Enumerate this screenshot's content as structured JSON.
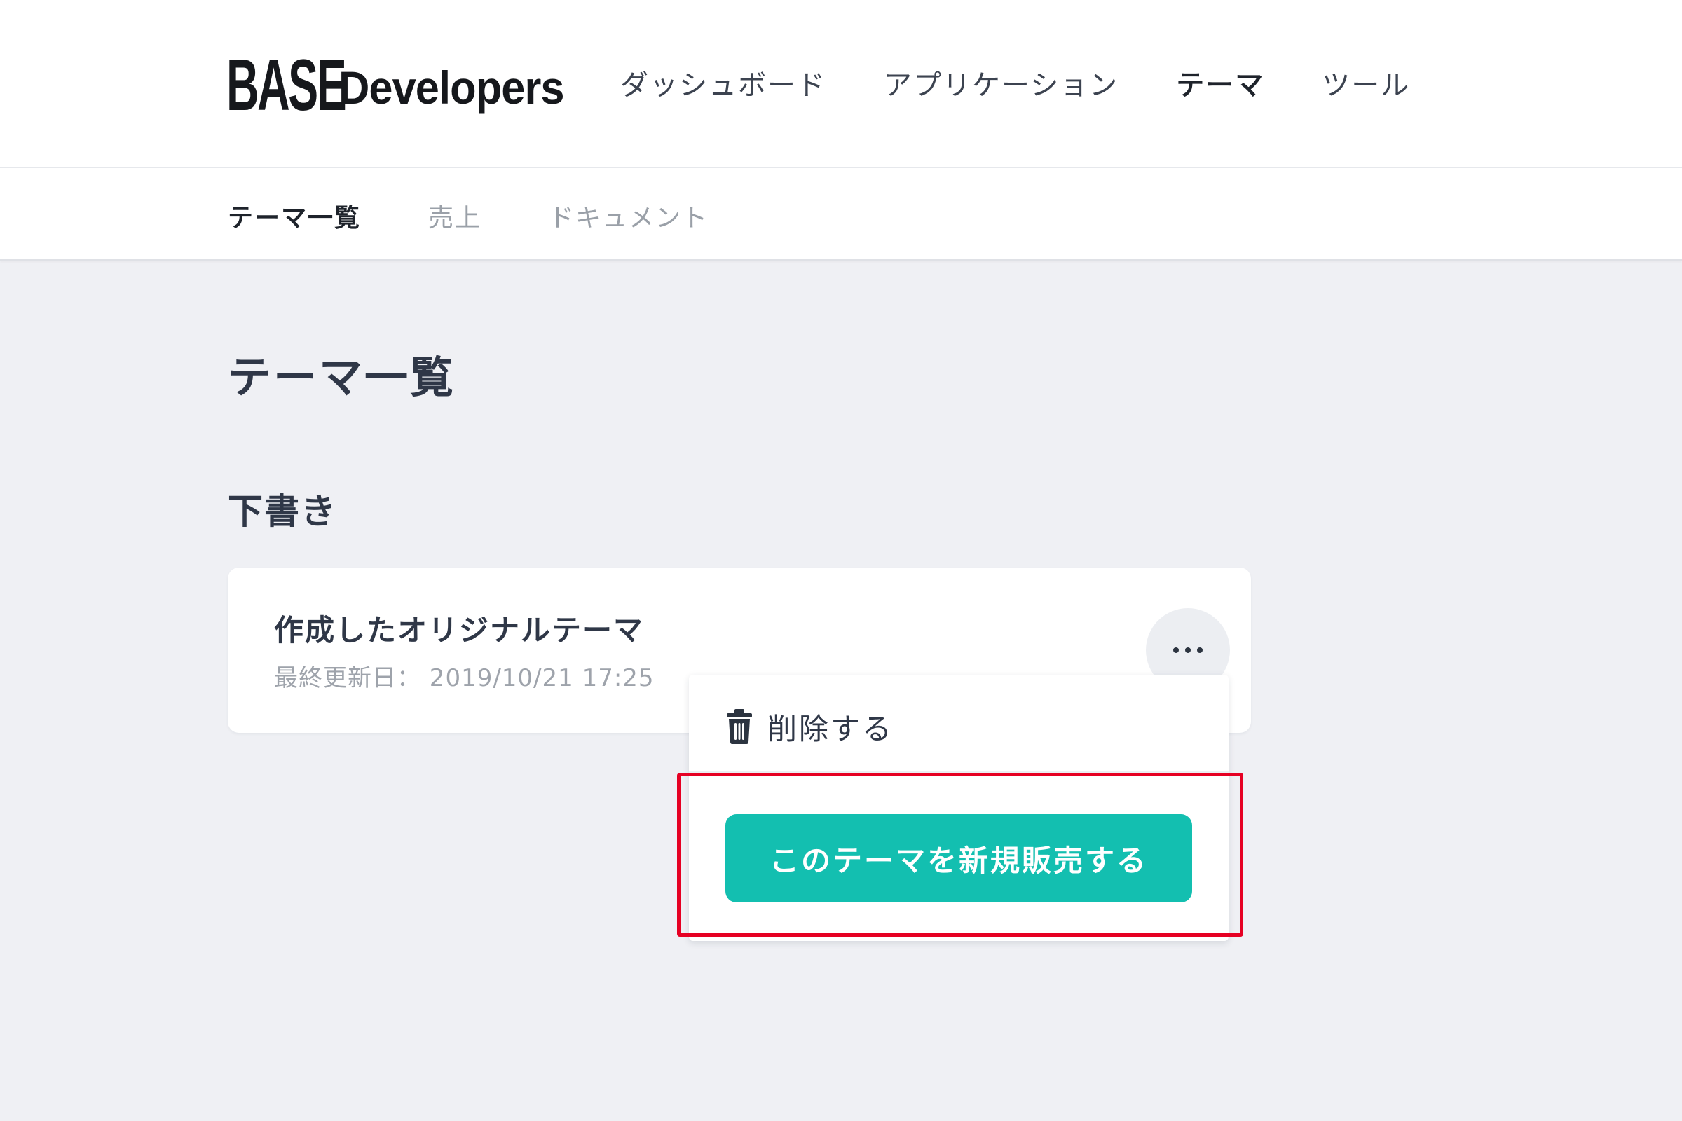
{
  "header": {
    "logo_mark": "BASE",
    "logo_text": "Developers",
    "nav": [
      {
        "label": "ダッシュボード",
        "active": false
      },
      {
        "label": "アプリケーション",
        "active": false
      },
      {
        "label": "テーマ",
        "active": true
      },
      {
        "label": "ツール",
        "active": false
      }
    ]
  },
  "subnav": {
    "items": [
      {
        "label": "テーマ一覧",
        "active": true
      },
      {
        "label": "売上",
        "active": false
      },
      {
        "label": "ドキュメント",
        "active": false
      }
    ]
  },
  "main": {
    "page_title": "テーマ一覧",
    "section_title": "下書き",
    "theme_card": {
      "name": "作成したオリジナルテーマ",
      "updated": "最終更新日： 2019/10/21 17:25",
      "more_icon": "ellipsis-icon"
    },
    "menu": {
      "delete_icon": "trash-icon",
      "delete_label": "削除する",
      "sell_button_label": "このテーマを新規販売する"
    }
  },
  "colors": {
    "accent": "#13bfb0",
    "highlight": "#e60023",
    "background": "#eff0f4",
    "text_dark": "#2f3747",
    "text_muted": "#9ea3ab"
  }
}
